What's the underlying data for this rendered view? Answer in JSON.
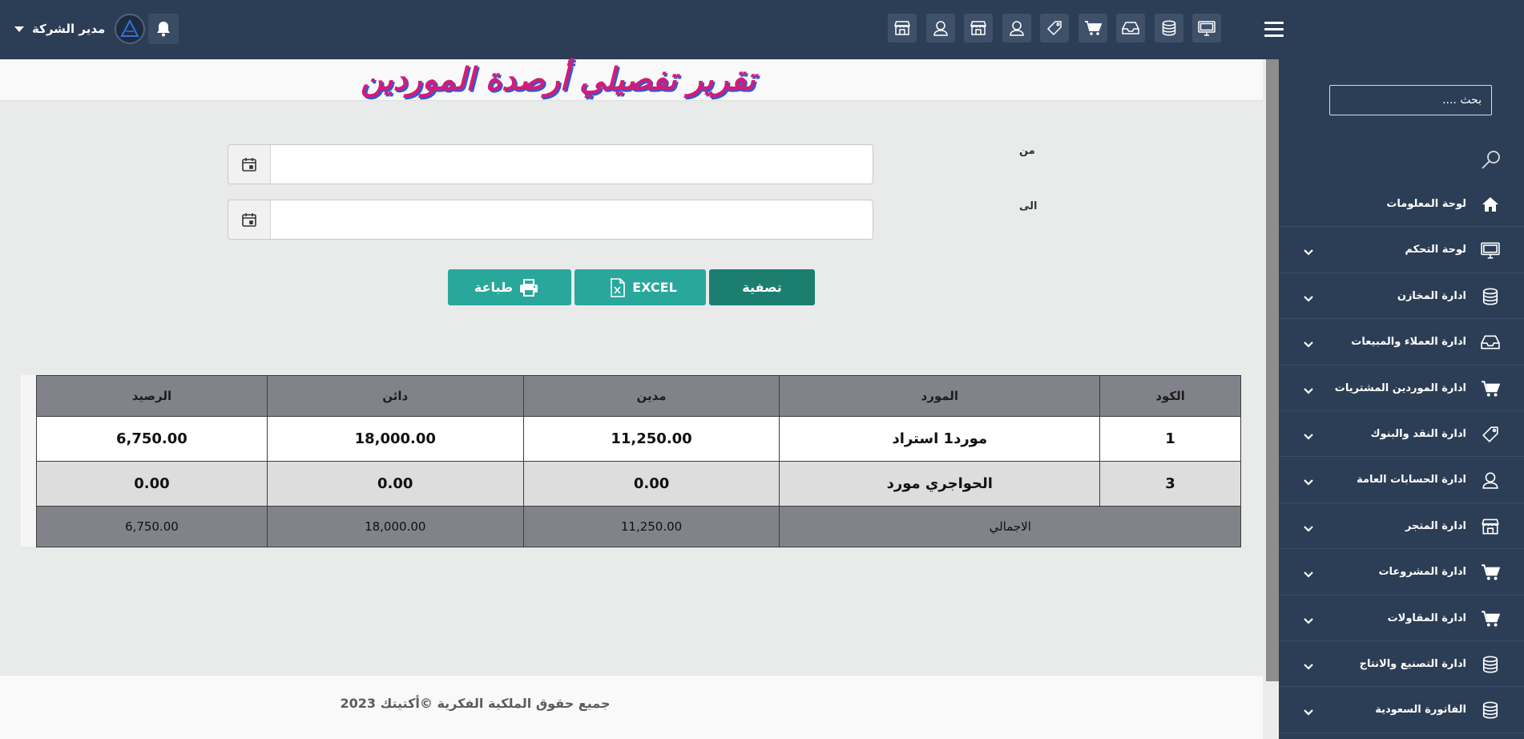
{
  "topbar": {
    "user_name": "مدير الشركة",
    "icons": [
      "store-icon",
      "user-icon",
      "store-icon",
      "user-icon",
      "tag-icon",
      "cart-icon",
      "inbox-icon",
      "database-icon",
      "monitor-icon"
    ]
  },
  "sidebar": {
    "search_placeholder": "بحث ....",
    "items": [
      {
        "label": "لوحة المعلومات",
        "icon": "home-icon",
        "has_submenu": false
      },
      {
        "label": "لوحة التحكم",
        "icon": "monitor-icon",
        "has_submenu": true
      },
      {
        "label": "ادارة المخازن",
        "icon": "database-icon",
        "has_submenu": true
      },
      {
        "label": "ادارة العملاء والمبيعات",
        "icon": "inbox-icon",
        "has_submenu": true
      },
      {
        "label": "ادارة الموردين المشتريات",
        "icon": "cart-icon",
        "has_submenu": true
      },
      {
        "label": "ادارة النقد والبنوك",
        "icon": "tag-icon",
        "has_submenu": true
      },
      {
        "label": "ادارة الحسابات العامة",
        "icon": "user-icon",
        "has_submenu": true
      },
      {
        "label": "ادارة المتجر",
        "icon": "store-icon",
        "has_submenu": true
      },
      {
        "label": "ادارة المشروعات",
        "icon": "cart-icon",
        "has_submenu": true
      },
      {
        "label": "ادارة المقاولات",
        "icon": "cart-icon",
        "has_submenu": true
      },
      {
        "label": "ادارة التصنيع والانتاج",
        "icon": "database-icon",
        "has_submenu": true
      },
      {
        "label": "الفاتورة السعودية",
        "icon": "database-icon",
        "has_submenu": true
      }
    ]
  },
  "page": {
    "title": "تقرير تفصيلي أرصدة الموردين",
    "from_label": "من",
    "to_label": "الى",
    "from_value": "",
    "to_value": ""
  },
  "buttons": {
    "print": "طباعة",
    "excel": "EXCEL",
    "filter": "تصفية"
  },
  "table": {
    "headers": [
      "الكود",
      "المورد",
      "مدين",
      "دائن",
      "الرصيد"
    ],
    "rows": [
      [
        "1",
        "مورد1 استراد",
        "11,250.00",
        "18,000.00",
        "6,750.00"
      ],
      [
        "3",
        "الحواجري مورد",
        "0.00",
        "0.00",
        "0.00"
      ]
    ],
    "total": {
      "label": "الاجمالي",
      "debit": "11,250.00",
      "credit": "18,000.00",
      "balance": "6,750.00"
    }
  },
  "footer": {
    "text": "جميع حقوق الملكية الفكرية ©أكتيتك 2023"
  },
  "colors": {
    "topbar": "#2c3e55",
    "accent": "#2aa79b",
    "accent_dark": "#1c7e6f",
    "title": "#d11d78",
    "title_shadow": "#2c5ad6",
    "table_header": "#82838a"
  }
}
